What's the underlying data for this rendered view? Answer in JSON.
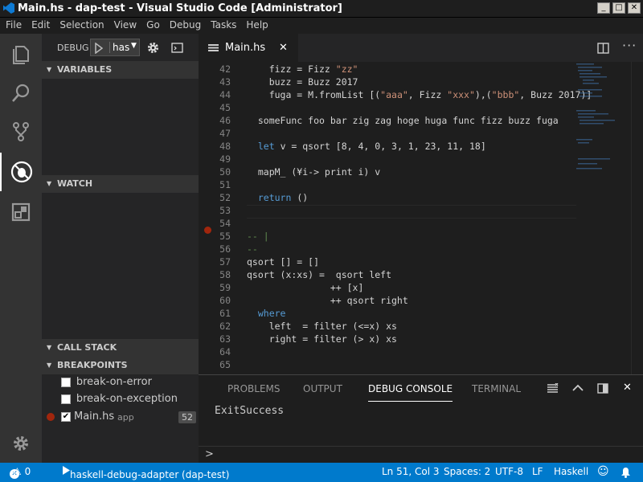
{
  "window": {
    "title": "Main.hs - dap-test - Visual Studio Code [Administrator]",
    "min": "_",
    "max": "□",
    "close": "✕"
  },
  "menu": [
    "File",
    "Edit",
    "Selection",
    "View",
    "Go",
    "Debug",
    "Tasks",
    "Help"
  ],
  "debug": {
    "label": "DEBUG",
    "config": "has"
  },
  "sidebar": {
    "variables": "VARIABLES",
    "watch": "WATCH",
    "callstack": "CALL STACK",
    "breakpoints": "BREAKPOINTS",
    "bp_items": [
      {
        "label": "break-on-error",
        "checked": false
      },
      {
        "label": "break-on-exception",
        "checked": false
      },
      {
        "label": "Main.hs",
        "sub": "app",
        "line": "52",
        "checked": true
      }
    ]
  },
  "editor": {
    "tab": "Main.hs",
    "lines": [
      {
        "n": "42",
        "t": "    fizz = Fizz \"zz\""
      },
      {
        "n": "43",
        "t": "    buzz = Buzz 2017"
      },
      {
        "n": "44",
        "t": "    fuga = M.fromList [(\"aaa\", Fizz \"xxx\"),(\"bbb\", Buzz 2017)]"
      },
      {
        "n": "45",
        "t": ""
      },
      {
        "n": "46",
        "t": "  someFunc foo bar zig zag hoge huga func fizz buzz fuga"
      },
      {
        "n": "47",
        "t": ""
      },
      {
        "n": "48",
        "t": "  let v = qsort [8, 4, 0, 3, 1, 23, 11, 18]"
      },
      {
        "n": "49",
        "t": ""
      },
      {
        "n": "50",
        "t": "  mapM_ (¥i-> print i) v"
      },
      {
        "n": "51",
        "t": ""
      },
      {
        "n": "52",
        "t": "  return ()"
      },
      {
        "n": "53",
        "t": ""
      },
      {
        "n": "54",
        "t": ""
      },
      {
        "n": "55",
        "t": "-- |"
      },
      {
        "n": "56",
        "t": "--"
      },
      {
        "n": "57",
        "t": "qsort [] = []"
      },
      {
        "n": "58",
        "t": "qsort (x:xs) =  qsort left"
      },
      {
        "n": "59",
        "t": "               ++ [x]"
      },
      {
        "n": "60",
        "t": "               ++ qsort right"
      },
      {
        "n": "61",
        "t": "  where"
      },
      {
        "n": "62",
        "t": "    left  = filter (<=x) xs"
      },
      {
        "n": "63",
        "t": "    right = filter (> x) xs"
      },
      {
        "n": "64",
        "t": ""
      },
      {
        "n": "65",
        "t": ""
      }
    ]
  },
  "panel": {
    "tabs": [
      "PROBLEMS",
      "OUTPUT",
      "DEBUG CONSOLE",
      "TERMINAL"
    ],
    "active": "DEBUG CONSOLE",
    "output": "ExitSuccess",
    "prompt": ">"
  },
  "status": {
    "errors": "0",
    "warnings": "0",
    "adapter": "haskell-debug-adapter (dap-test)",
    "position": "Ln 51, Col 3",
    "spaces": "Spaces: 2",
    "encoding": "UTF-8",
    "eol": "LF",
    "lang": "Haskell"
  },
  "colors": {
    "accent": "#007acc",
    "breakpoint": "#a1260d"
  }
}
